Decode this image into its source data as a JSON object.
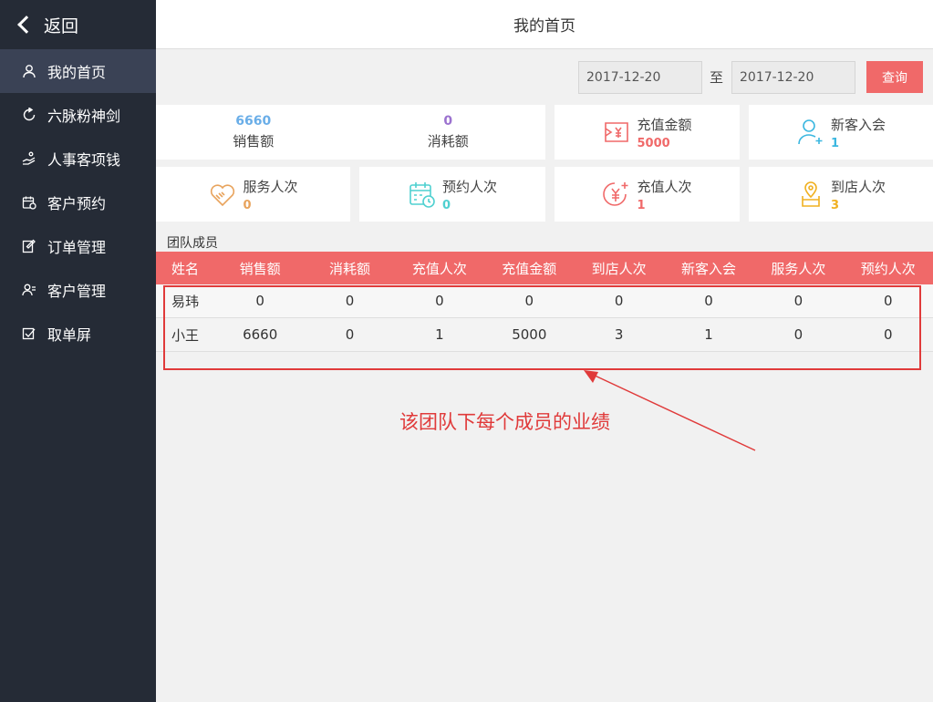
{
  "sidebar": {
    "back_label": "返回",
    "items": [
      {
        "label": "我的首页",
        "icon": "user-icon"
      },
      {
        "label": "六脉粉神剑",
        "icon": "refresh-icon"
      },
      {
        "label": "人事客项钱",
        "icon": "hand-icon"
      },
      {
        "label": "客户预约",
        "icon": "calendar-icon"
      },
      {
        "label": "订单管理",
        "icon": "edit-icon"
      },
      {
        "label": "客户管理",
        "icon": "users-icon"
      },
      {
        "label": "取单屏",
        "icon": "checkbox-icon"
      }
    ]
  },
  "header": {
    "title": "我的首页"
  },
  "filter": {
    "start_date": "2017-12-20",
    "to_label": "至",
    "end_date": "2017-12-20",
    "query_label": "查询"
  },
  "stats": {
    "sales": {
      "value": "6660",
      "label": "销售额",
      "color": "#6aaee8"
    },
    "consumption": {
      "value": "0",
      "label": "消耗额",
      "color": "#9b72cf"
    },
    "recharge_amount": {
      "value": "5000",
      "label": "充值金额",
      "color": "#f06969",
      "icon": "money-card-icon"
    },
    "new_members": {
      "value": "1",
      "label": "新客入会",
      "color": "#3bb7e0",
      "icon": "user-add-icon"
    },
    "service_count": {
      "value": "0",
      "label": "服务人次",
      "color": "#e8a35c",
      "icon": "heart-hands-icon"
    },
    "appointment_count": {
      "value": "0",
      "label": "预约人次",
      "color": "#4fd0d0",
      "icon": "calendar-clock-icon"
    },
    "recharge_count": {
      "value": "1",
      "label": "充值人次",
      "color": "#f06969",
      "icon": "yen-plus-icon"
    },
    "store_visits": {
      "value": "3",
      "label": "到店人次",
      "color": "#f0b020",
      "icon": "store-pin-icon"
    }
  },
  "team": {
    "title": "团队成员",
    "columns": [
      "姓名",
      "销售额",
      "消耗额",
      "充值人次",
      "充值金额",
      "到店人次",
      "新客入会",
      "服务人次",
      "预约人次"
    ],
    "rows": [
      [
        "易玮",
        "0",
        "0",
        "0",
        "0",
        "0",
        "0",
        "0",
        "0"
      ],
      [
        "小王",
        "6660",
        "0",
        "1",
        "5000",
        "3",
        "1",
        "0",
        "0"
      ]
    ]
  },
  "annotation": {
    "text": "该团队下每个成员的业绩",
    "color": "#e03a3a"
  }
}
